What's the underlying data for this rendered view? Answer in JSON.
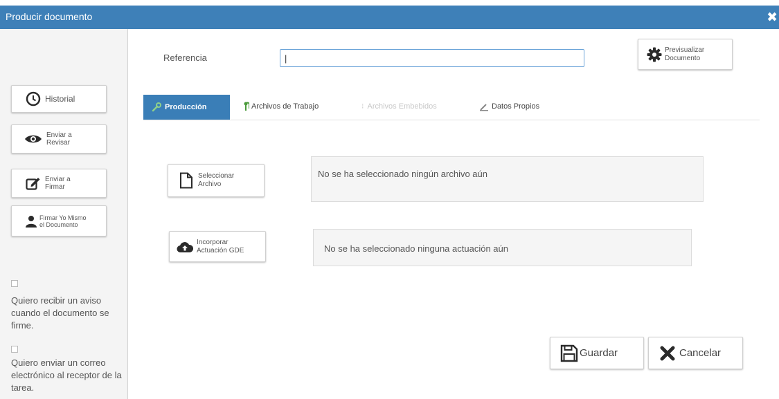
{
  "window": {
    "title": "Producir documento",
    "close_glyph": "✖"
  },
  "sidebar": {
    "historial": "Historial",
    "enviar_revisar_1": "Enviar a",
    "enviar_revisar_2": "Revisar",
    "enviar_firmar_1": "Enviar a",
    "enviar_firmar_2": "Firmar",
    "firmar_yo_1": "Firmar Yo Mismo",
    "firmar_yo_2": "el Documento",
    "aviso_text": "Quiero recibir un aviso cuando el documento se firme.",
    "correo_text": "Quiero enviar un correo electrónico al receptor de la tarea."
  },
  "form": {
    "referencia_label": "Referencia",
    "referencia_value": "|",
    "previsualizar_1": "Previsualizar",
    "previsualizar_2": "Documento"
  },
  "tabs": {
    "produccion": "Producción",
    "archivos_trabajo": "Archivos de Trabajo",
    "archivos_embebidos": "Archivos Embebidos",
    "datos_propios": "Datos Propios"
  },
  "main": {
    "seleccionar_1": "Seleccionar",
    "seleccionar_2": "Archivo",
    "no_archivo": "No se ha seleccionado ningún archivo aún",
    "incorporar_1": "Incorporar",
    "incorporar_2": "Actuación GDE",
    "no_actuacion": "No se ha seleccionado ninguna actuación aún"
  },
  "actions": {
    "guardar": "Guardar",
    "cancelar": "Cancelar"
  },
  "colors": {
    "titlebar": "#3e80b8",
    "tab_active": "#3a7eb7",
    "input_border": "#6aa3d8"
  }
}
